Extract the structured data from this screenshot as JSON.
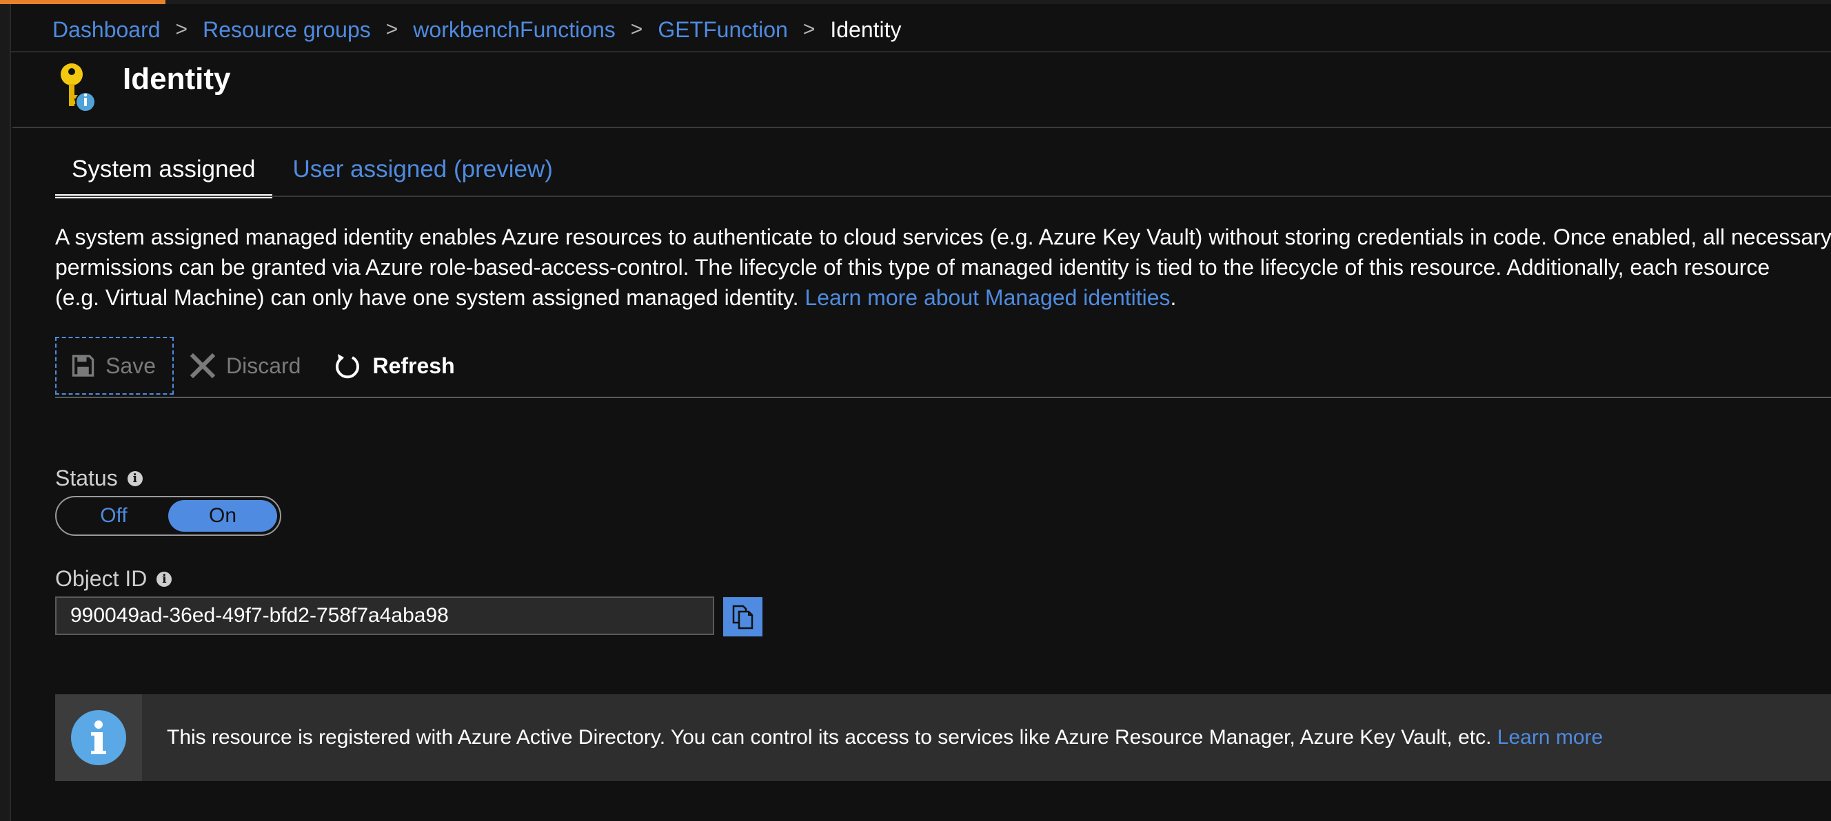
{
  "colors": {
    "background": "#111111",
    "link": "#4f8be0",
    "accent_orange": "#e8822a",
    "text": "#ffffff"
  },
  "breadcrumb": {
    "items": [
      "Dashboard",
      "Resource groups",
      "workbenchFunctions",
      "GETFunction"
    ],
    "separator": ">",
    "current": "Identity"
  },
  "blade": {
    "title": "Identity",
    "icon": "key-identity-icon"
  },
  "tabs": [
    {
      "label": "System assigned",
      "active": true
    },
    {
      "label": "User assigned (preview)",
      "active": false
    }
  ],
  "description": {
    "line1": "A system assigned managed identity enables Azure resources to authenticate to cloud services (e.g. Azure Key Vault) without storing credentials in code. Once enabled, all necessary",
    "line2": "permissions can be granted via Azure role-based-access-control. The lifecycle of this type of managed identity is tied to the lifecycle of this resource. Additionally, each resource",
    "line3": "(e.g. Virtual Machine) can only have one system assigned managed identity. ",
    "link": "Learn more about Managed identities",
    "trailing": "."
  },
  "toolbar": {
    "save_label": "Save",
    "discard_label": "Discard",
    "refresh_label": "Refresh"
  },
  "status": {
    "label": "Status",
    "off_label": "Off",
    "on_label": "On",
    "selected": "On"
  },
  "object_id": {
    "label": "Object ID",
    "value": "990049ad-36ed-49f7-bfd2-758f7a4aba98"
  },
  "info_banner": {
    "text": "This resource is registered with Azure Active Directory. You can control its access to services like Azure Resource Manager, Azure Key Vault, etc. ",
    "link": "Learn more"
  }
}
